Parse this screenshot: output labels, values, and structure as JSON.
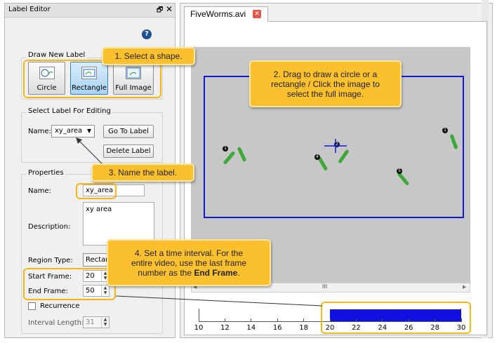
{
  "label_editor": {
    "title": "Label Editor",
    "float_glyph": "🗗",
    "close_glyph": "✕",
    "help_glyph": "?",
    "draw_group": {
      "title": "Draw New Label",
      "buttons": [
        {
          "label": "Circle",
          "icon": "circle-shape-icon",
          "selected": false
        },
        {
          "label": "Rectangle",
          "icon": "rectangle-shape-icon",
          "selected": true
        },
        {
          "label": "Full Image",
          "icon": "full-image-shape-icon",
          "selected": false
        }
      ]
    },
    "select_group": {
      "title": "Select Label For Editing",
      "name_label": "Name:",
      "selected_name": "xy_area",
      "dropdown_arrow": "▼",
      "go_to_label": "Go To Label",
      "delete_label": "Delete Label"
    },
    "properties": {
      "title": "Properties",
      "name_label": "Name:",
      "name_value": "xy_area",
      "description_label": "Description:",
      "description_value": "xy area",
      "region_type_label": "Region Type:",
      "region_type_value": "Rectan",
      "start_frame_label": "Start Frame:",
      "start_frame_value": "20",
      "end_frame_label": "End Frame:",
      "end_frame_value": "50",
      "recurrence_label": "Recurrence",
      "interval_length_label": "Interval Length:",
      "interval_length_value": "31"
    }
  },
  "viewer": {
    "tab_title": "FiveWorms.avi",
    "tab_close_glyph": "✕",
    "scroll_thumb_glyph": "III",
    "scroll_left_glyph": "◀",
    "scroll_right_glyph": "▶",
    "worm_markers": [
      "1",
      "2",
      "3",
      "4",
      "5"
    ],
    "timeline": {
      "ticks": [
        "10",
        "12",
        "14",
        "16",
        "18",
        "20",
        "22",
        "24",
        "26",
        "28",
        "30"
      ],
      "interval_color": "#1010e0"
    }
  },
  "callouts": {
    "step1": "1. Select a shape.",
    "step2_line1": "2. Drag to draw a circle or a",
    "step2_line2": "rectangle / Click the image to",
    "step2_line3": "select the full image.",
    "step3": "3. Name the label.",
    "step4_line1": "4. Set a time interval. For the",
    "step4_line2": "entire video, use the last frame",
    "step4_line3_prefix": "number as the ",
    "step4_line3_bold": "End Frame",
    "step4_line3_suffix": "."
  },
  "colors": {
    "callout": "#fbc02d",
    "highlight": "#f9b613",
    "selection_rect": "#1118d8",
    "selected_button": "#a9d3f3"
  }
}
